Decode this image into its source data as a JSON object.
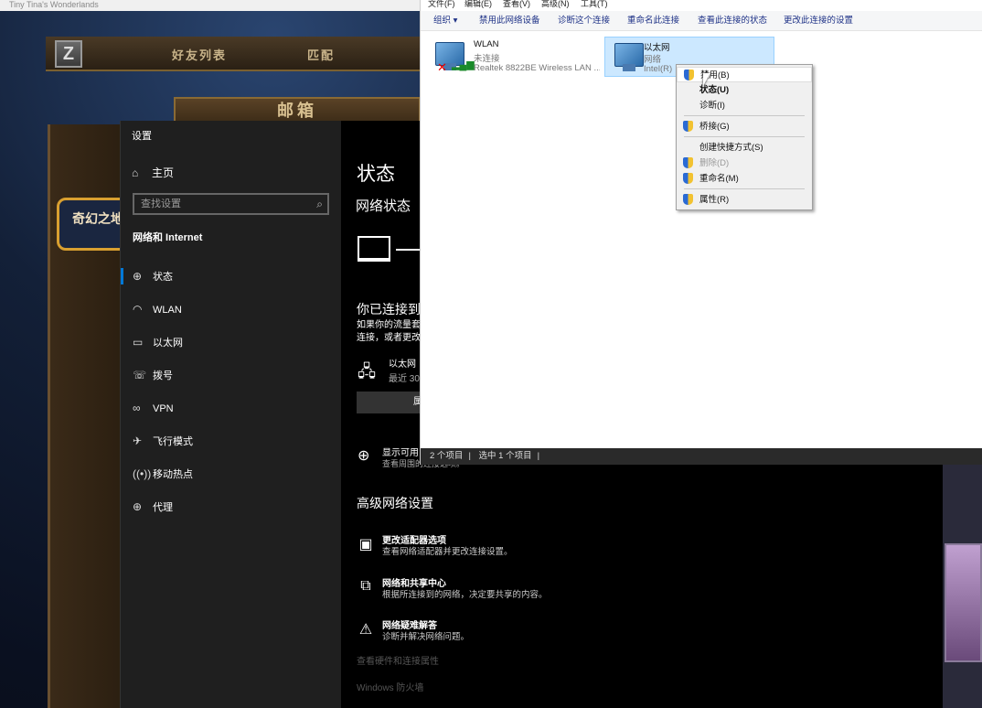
{
  "game": {
    "window_title": "Tiny Tina's Wonderlands",
    "z_label": "Z",
    "nav": [
      "好友列表",
      "匹配"
    ],
    "mail_tab": "邮箱",
    "wonder_label": "奇幻之地"
  },
  "settings": {
    "window_title": "设置",
    "home": "主页",
    "search_placeholder": "查找设置",
    "section": "网络和 Internet",
    "nav": [
      {
        "label": "状态",
        "icon": "status-icon"
      },
      {
        "label": "WLAN",
        "icon": "wifi-icon"
      },
      {
        "label": "以太网",
        "icon": "ethernet-icon"
      },
      {
        "label": "拨号",
        "icon": "dialup-icon"
      },
      {
        "label": "VPN",
        "icon": "vpn-icon"
      },
      {
        "label": "飞行模式",
        "icon": "airplane-icon"
      },
      {
        "label": "移动热点",
        "icon": "hotspot-icon"
      },
      {
        "label": "代理",
        "icon": "proxy-icon"
      }
    ],
    "main": {
      "title": "状态",
      "network_status": "网络状态",
      "connected": "你已连接到",
      "conn_desc1": "如果你的流量套",
      "conn_desc2": "连接，或者更改",
      "eth_name": "以太网",
      "eth_sub": "最近 30",
      "props_btn": "属",
      "show_title": "显示可用",
      "show_sub": "查看周围的连接选项。",
      "advanced": "高级网络设置",
      "adv_items": [
        {
          "title": "更改适配器选项",
          "sub": "查看网络适配器并更改连接设置。",
          "icon": "adapter-icon"
        },
        {
          "title": "网络和共享中心",
          "sub": "根据所连接到的网络，决定要共享的内容。",
          "icon": "sharing-icon"
        },
        {
          "title": "网络疑难解答",
          "sub": "诊断并解决网络问题。",
          "icon": "warning-icon"
        }
      ],
      "link1": "查看硬件和连接属性",
      "link2": "Windows 防火墙"
    }
  },
  "explorer": {
    "menu": [
      "文件(F)",
      "编辑(E)",
      "查看(V)",
      "高级(N)",
      "工具(T)"
    ],
    "toolbar": [
      "组织 ▾",
      "禁用此网络设备",
      "诊断这个连接",
      "重命名此连接",
      "查看此连接的状态",
      "更改此连接的设置"
    ],
    "adapters": [
      {
        "name": "WLAN",
        "status": "未连接",
        "device": "Realtek 8822BE Wireless LAN ..."
      },
      {
        "name": "以太网",
        "status": "网络",
        "device": "Intel(R)"
      }
    ],
    "status": {
      "items": "2 个项目",
      "selected": "选中 1 个项目"
    }
  },
  "context_menu": {
    "items": [
      {
        "label": "禁用(B)",
        "shield": true,
        "state": "hover"
      },
      {
        "label": "状态(U)",
        "shield": false,
        "state": "bold"
      },
      {
        "label": "诊断(I)",
        "shield": false,
        "state": "normal"
      },
      {
        "label": "桥接(G)",
        "shield": true,
        "state": "normal"
      },
      {
        "label": "创建快捷方式(S)",
        "shield": false,
        "state": "normal"
      },
      {
        "label": "删除(D)",
        "shield": true,
        "state": "disabled"
      },
      {
        "label": "重命名(M)",
        "shield": true,
        "state": "normal"
      },
      {
        "label": "属性(R)",
        "shield": true,
        "state": "normal"
      }
    ]
  }
}
